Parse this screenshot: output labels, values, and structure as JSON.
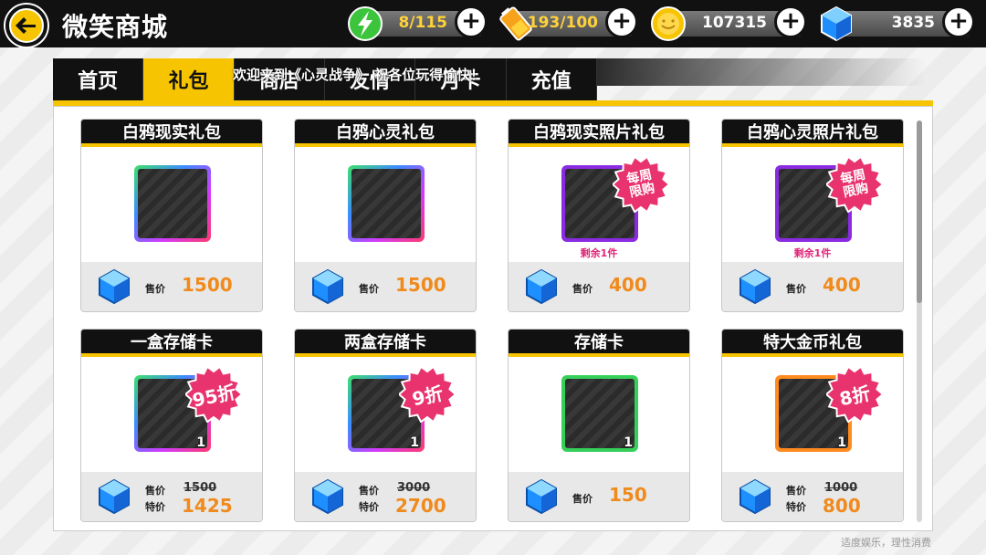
{
  "header": {
    "title": "微笑商城",
    "stamina": {
      "current": "8",
      "max": "115"
    },
    "energy": {
      "current": "193",
      "max": "100"
    },
    "coins": "107315",
    "gems": "3835"
  },
  "tabs": [
    {
      "label": "首页",
      "active": false
    },
    {
      "label": "礼包",
      "active": true
    },
    {
      "label": "商店",
      "active": false
    },
    {
      "label": "友情",
      "active": false
    },
    {
      "label": "月卡",
      "active": false
    },
    {
      "label": "充值",
      "active": false
    }
  ],
  "marquee": "欢迎来到《心灵战争》 祝各位玩得愉快！",
  "labels": {
    "price": "售价",
    "sale": "特价"
  },
  "items": [
    {
      "name": "白鸦现实礼包",
      "price": "1500",
      "frame": "rainbow"
    },
    {
      "name": "白鸦心灵礼包",
      "price": "1500",
      "frame": "rainbow"
    },
    {
      "name": "白鸦现实照片礼包",
      "price": "400",
      "frame": "purple",
      "badge": "每周\n限购",
      "remain": "剩余1件"
    },
    {
      "name": "白鸦心灵照片礼包",
      "price": "400",
      "frame": "purple",
      "badge": "每周\n限购",
      "remain": "剩余1件"
    },
    {
      "name": "一盒存储卡",
      "orig": "1500",
      "price": "1425",
      "frame": "rainbow",
      "badge": "95折",
      "count": "1"
    },
    {
      "name": "两盒存储卡",
      "orig": "3000",
      "price": "2700",
      "frame": "rainbow",
      "badge": "9折",
      "count": "1"
    },
    {
      "name": "存储卡",
      "price": "150",
      "frame": "green",
      "count": "1"
    },
    {
      "name": "特大金币礼包",
      "orig": "1000",
      "price": "800",
      "frame": "orange",
      "badge": "8折",
      "count": "1"
    }
  ],
  "footer_note": "适度娱乐，理性消费",
  "colors": {
    "accent": "#f6c400",
    "price": "#f08a1c",
    "badge": "#e8336f",
    "bar": "#111111"
  }
}
